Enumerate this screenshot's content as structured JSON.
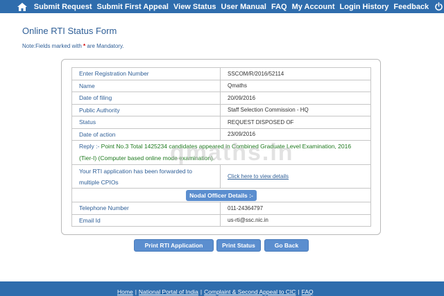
{
  "nav": {
    "items": [
      "Submit Request",
      "Submit First Appeal",
      "View Status",
      "User Manual",
      "FAQ",
      "My Account",
      "Login History",
      "Feedback"
    ],
    "home_icon": "home-icon",
    "power_icon": "power-icon"
  },
  "page": {
    "title": "Online RTI Status Form",
    "note_prefix": "Note:Fields marked with ",
    "note_star": "*",
    "note_suffix": " are Mandatory."
  },
  "details": {
    "registration": {
      "label": "Enter Registration Number",
      "value": "SSCOM/R/2016/52114"
    },
    "name": {
      "label": "Name",
      "value": "Qmaths"
    },
    "filing": {
      "label": "Date of filing",
      "value": "20/09/2016"
    },
    "authority": {
      "label": "Public Authority",
      "value": "Staff Selection Commission - HQ"
    },
    "status": {
      "label": "Status",
      "value": "REQUEST DISPOSED OF"
    },
    "action": {
      "label": "Date of action",
      "value": "23/09/2016"
    },
    "reply": {
      "label": "Reply :-",
      "text": " Point No.3 Total 1425234 candidates appeared in Combined Graduate Level Examination, 2016 (Tier-I) (Computer based online mode examination)."
    },
    "forwarded": {
      "label": "Your RTI application has been forwarded to multiple CPIOs",
      "link": "Click here to view details"
    },
    "nodal_heading": "Nodal Officer Details :-",
    "telephone": {
      "label": "Telephone Number",
      "value": "011-24364797"
    },
    "email": {
      "label": "Email Id",
      "value": "us-rti@ssc.nic.in"
    }
  },
  "buttons": {
    "print_application": "Print RTI Application",
    "print_status": "Print Status",
    "go_back": "Go Back"
  },
  "footer": {
    "links": [
      "Home",
      "National Portal of India",
      "Complaint & Second Appeal to CIC",
      "FAQ"
    ],
    "separator": "|"
  },
  "watermark": "qmaths.in",
  "colors": {
    "nav_bg": "#2f6dad",
    "button_bg": "#5b8ecf",
    "label": "#2f5f97",
    "reply_text": "#1f7a1f"
  }
}
